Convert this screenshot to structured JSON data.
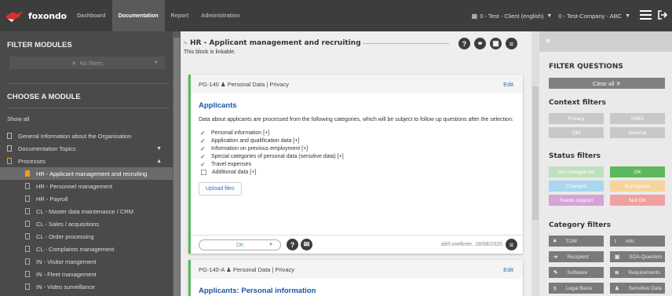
{
  "app": {
    "name": "foxondo"
  },
  "nav": {
    "tabs": [
      "Dashboard",
      "Documentation",
      "Report",
      "Administration"
    ],
    "active": "Documentation"
  },
  "topbar": {
    "client": "0 - Test - Client (english)",
    "company": "0 - Test-Company - ABC"
  },
  "sidebar": {
    "filter_title": "FILTER MODULES",
    "filter_value": "No filters",
    "choose_title": "CHOOSE A MODULE",
    "show_all": "Show all",
    "items": [
      {
        "label": "General Information about the Organisation",
        "level": 0
      },
      {
        "label": "Documentation Topics",
        "level": 0,
        "arrow": "down"
      },
      {
        "label": "Processes",
        "level": 0,
        "arrow": "up",
        "color": "#f59c1a"
      },
      {
        "label": "HR - Applicant management and recruiting",
        "level": 1,
        "selected": true
      },
      {
        "label": "HR - Personnel management",
        "level": 1
      },
      {
        "label": "HR - Payroll",
        "level": 1
      },
      {
        "label": "CL - Master data maintenance / CRM",
        "level": 1
      },
      {
        "label": "CL - Sales / acquisitions",
        "level": 1
      },
      {
        "label": "CL - Order processing",
        "level": 1
      },
      {
        "label": "CL - Complaints management",
        "level": 1
      },
      {
        "label": "IN - Visitor mangement",
        "level": 1
      },
      {
        "label": "IN - Fleet management",
        "level": 1
      },
      {
        "label": "IN - Video surveillance",
        "level": 1
      }
    ]
  },
  "main": {
    "title": "HR - Applicant management and recruiting",
    "subtitle": "This block is linkable.",
    "cards": [
      {
        "id_line": "PG-140 ♟ Personal Data | Privacy",
        "edit": "Edit",
        "title": "Applicants",
        "text": "Data about applicants are processed from the following categories, which will be subject to follow up questions after the selection:",
        "items": [
          {
            "label": "Personal information [+]",
            "checked": true
          },
          {
            "label": "Application and qualification data [+]",
            "checked": true
          },
          {
            "label": "Information on previous employment [+]",
            "checked": true
          },
          {
            "label": "Special categories of personal data (sensitive data) [+]",
            "checked": true
          },
          {
            "label": "Travel expenses",
            "checked": true
          },
          {
            "label": "Additional data [+]",
            "checked": false
          }
        ],
        "upload": "Upload files",
        "status": "OK",
        "meta": "alef.voelkner, 18/08/2020"
      },
      {
        "id_line": "PG-140-A ♟ Personal Data | Privacy",
        "edit": "Edit",
        "title": "Applicants: Personal information"
      }
    ]
  },
  "right_panel": {
    "title": "FILTER QUESTIONS",
    "clear": "Clear all ✕",
    "context_title": "Context filters",
    "context": [
      "Privacy",
      "ISMS",
      "QM",
      "General"
    ],
    "status_title": "Status filters",
    "status": [
      {
        "label": "Not changed yet",
        "color": "#bfe0bf"
      },
      {
        "label": "OK",
        "color": "#5cb85c"
      },
      {
        "label": "Changed",
        "color": "#a9d6f0"
      },
      {
        "label": "In progress",
        "color": "#f6d49a"
      },
      {
        "label": "Needs support",
        "color": "#d5a3d5"
      },
      {
        "label": "Not OK",
        "color": "#f0a0a0"
      }
    ],
    "category_title": "Category filters",
    "categories": [
      {
        "label": "TOM",
        "icon": "lock-icon"
      },
      {
        "label": "Info",
        "icon": "info-icon"
      },
      {
        "label": "Recipient",
        "icon": "arrow-icon"
      },
      {
        "label": "SOA-Question",
        "icon": "doc-icon"
      },
      {
        "label": "Software",
        "icon": "wrench-icon"
      },
      {
        "label": "Requirements",
        "icon": "list-icon"
      },
      {
        "label": "Legal Basis",
        "icon": "paragraph-icon"
      },
      {
        "label": "Sensitive Data",
        "icon": "users-icon"
      }
    ]
  }
}
